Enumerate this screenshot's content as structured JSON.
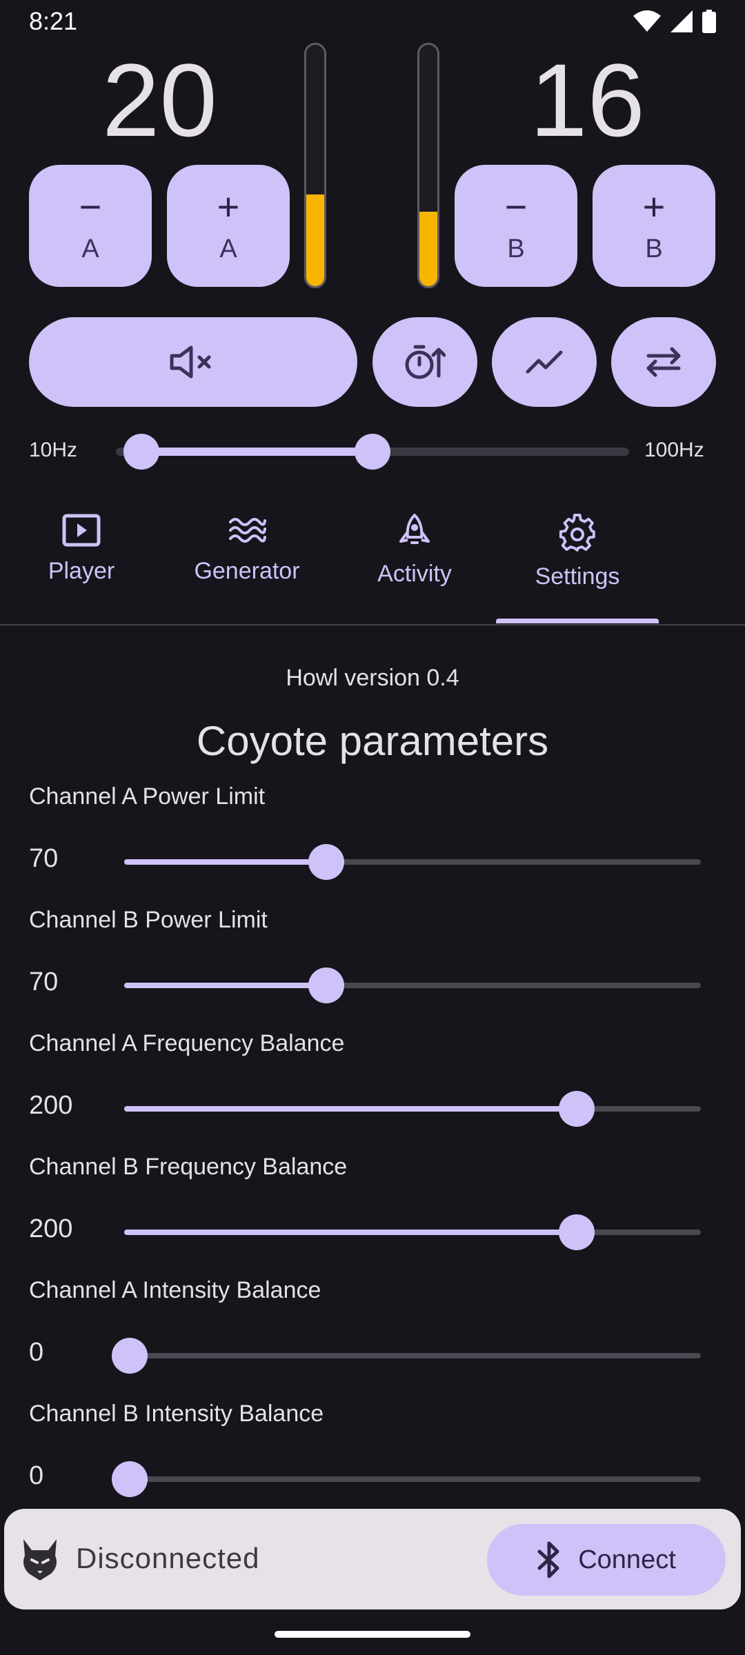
{
  "status": {
    "time": "8:21"
  },
  "power": {
    "a": "20",
    "b": "16",
    "a_meter_level": 0.38,
    "b_meter_level": 0.31
  },
  "buttons": {
    "dec_a": {
      "symbol": "−",
      "label": "A"
    },
    "inc_a": {
      "symbol": "+",
      "label": "A"
    },
    "dec_b": {
      "symbol": "−",
      "label": "B"
    },
    "inc_b": {
      "symbol": "+",
      "label": "B"
    },
    "mute_icon": "speaker-mute-icon",
    "timer_icon": "timer-up-icon",
    "chart_icon": "trend-line-icon",
    "swap_icon": "swap-arrows-icon"
  },
  "frequency_range": {
    "min_label": "10Hz",
    "max_label": "100Hz",
    "low_fraction": 0.05,
    "high_fraction": 0.5
  },
  "tabs": [
    {
      "label": "Player",
      "icon": "play-icon",
      "selected": false
    },
    {
      "label": "Generator",
      "icon": "waves-icon",
      "selected": false
    },
    {
      "label": "Activity",
      "icon": "rocket-icon",
      "selected": false
    },
    {
      "label": "Settings",
      "icon": "gear-icon",
      "selected": true
    }
  ],
  "settings": {
    "version": "Howl version 0.4",
    "section_title": "Coyote parameters",
    "params": [
      {
        "label": "Channel A Power Limit",
        "value": "70",
        "fraction": 0.35
      },
      {
        "label": "Channel B Power Limit",
        "value": "70",
        "fraction": 0.35
      },
      {
        "label": "Channel A Frequency Balance",
        "value": "200",
        "fraction": 0.785
      },
      {
        "label": "Channel B Frequency Balance",
        "value": "200",
        "fraction": 0.785
      },
      {
        "label": "Channel A Intensity Balance",
        "value": "0",
        "fraction": 0.0
      },
      {
        "label": "Channel B Intensity Balance",
        "value": "0",
        "fraction": 0.0
      }
    ]
  },
  "connection": {
    "status": "Disconnected",
    "button_label": "Connect",
    "logo": "wolf-logo-icon",
    "button_icon": "bluetooth-icon"
  },
  "colors": {
    "accent": "#cfc2f8",
    "meter": "#f7b500",
    "background": "#16151b"
  }
}
